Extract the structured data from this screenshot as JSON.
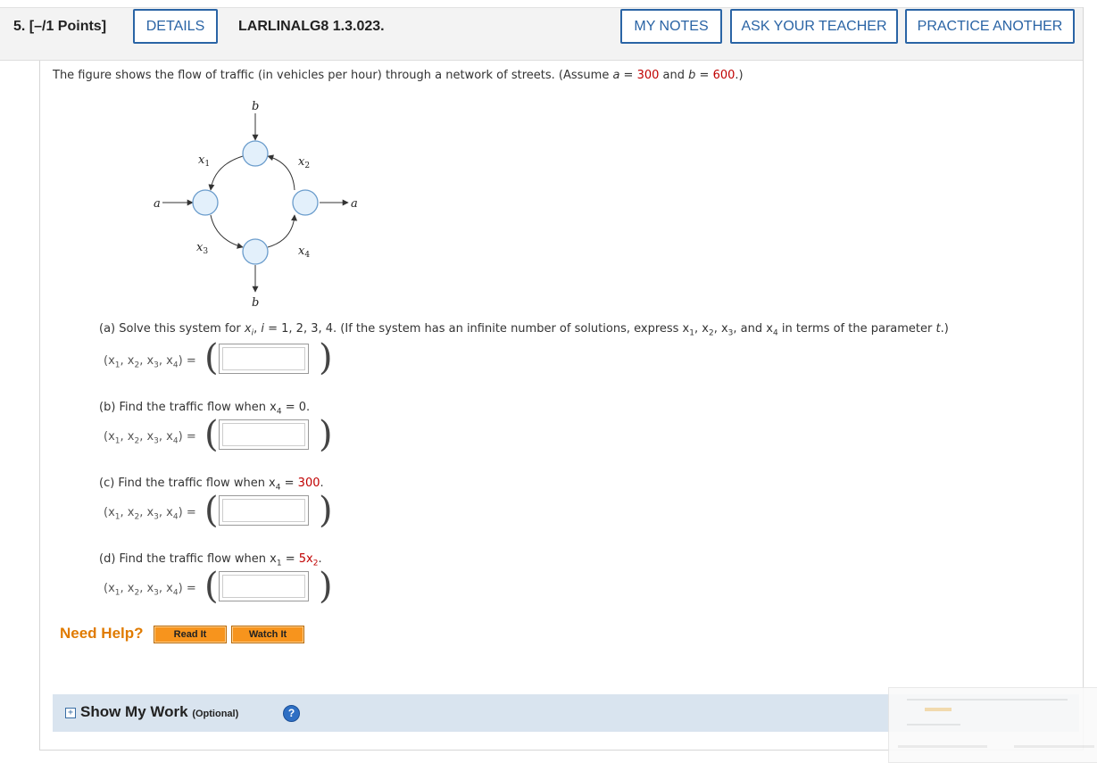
{
  "header": {
    "question_number": "5. [–/1 Points]",
    "details_label": "DETAILS",
    "code": "LARLINALG8 1.3.023.",
    "my_notes_label": "MY NOTES",
    "ask_teacher_label": "ASK YOUR TEACHER",
    "practice_another_label": "PRACTICE ANOTHER"
  },
  "intro": {
    "text_before": "The figure shows the flow of traffic (in vehicles per hour) through a network of streets. (Assume ",
    "a_var": "a",
    "eq1": " = ",
    "a_value": "300",
    "mid": " and ",
    "b_var": "b",
    "eq2": " = ",
    "b_value": "600",
    "text_after": ".)"
  },
  "figure": {
    "label_b_top": "b",
    "label_b_bottom": "b",
    "label_a_left": "a",
    "label_a_right": "a",
    "label_x1": "x",
    "sub_1": "1",
    "label_x2": "x",
    "sub_2": "2",
    "label_x3": "x",
    "sub_3": "3",
    "label_x4": "x",
    "sub_4": "4",
    "node_fill": "#e3f0fb",
    "node_stroke": "#6a9ccc"
  },
  "parts": [
    {
      "prompt_before": "(a) Solve this system for ",
      "prompt_var": "x",
      "prompt_sub": "i",
      "prompt_mid": ", ",
      "prompt_i": "i",
      "prompt_after": " = 1, 2, 3, 4.  (If the system has an infinite number of solutions, express x",
      "tail_1": "1",
      "tail_a": ", x",
      "tail_2": "2",
      "tail_b": ", x",
      "tail_3": "3",
      "tail_c": ", and x",
      "tail_4": "4",
      "tail_d": " in terms of the parameter ",
      "tail_t": "t",
      "tail_e": ".)"
    },
    {
      "prompt_before": "(b) Find the traffic flow when  x",
      "prompt_sub": "4",
      "prompt_eq": " = ",
      "prompt_value": "0",
      "prompt_end": "."
    },
    {
      "prompt_before": "(c) Find the traffic flow when  x",
      "prompt_sub": "4",
      "prompt_eq": " = ",
      "prompt_value": "300",
      "prompt_end": "."
    },
    {
      "prompt_before": "(d) Find the traffic flow when  x",
      "prompt_sub": "1",
      "prompt_eq": " = ",
      "prompt_value": "5x",
      "prompt_value_sub": "2",
      "prompt_end": "."
    }
  ],
  "tuple": {
    "open": "(x",
    "s1": "1",
    "c1": ", x",
    "s2": "2",
    "c2": ", x",
    "s3": "3",
    "c3": ", x",
    "s4": "4",
    "close": ")  ="
  },
  "answer": {
    "open_paren": "(",
    "close_paren": ")"
  },
  "help": {
    "need_help": "Need Help?",
    "read_it": "Read It",
    "watch_it": "Watch It"
  },
  "show_my_work": {
    "plus": "+",
    "label": "Show My Work",
    "optional": "(Optional)",
    "help_icon": "?"
  },
  "colors": {
    "accent_blue": "#2a64a5",
    "value_red": "#c00000",
    "help_orange": "#e07b00"
  }
}
